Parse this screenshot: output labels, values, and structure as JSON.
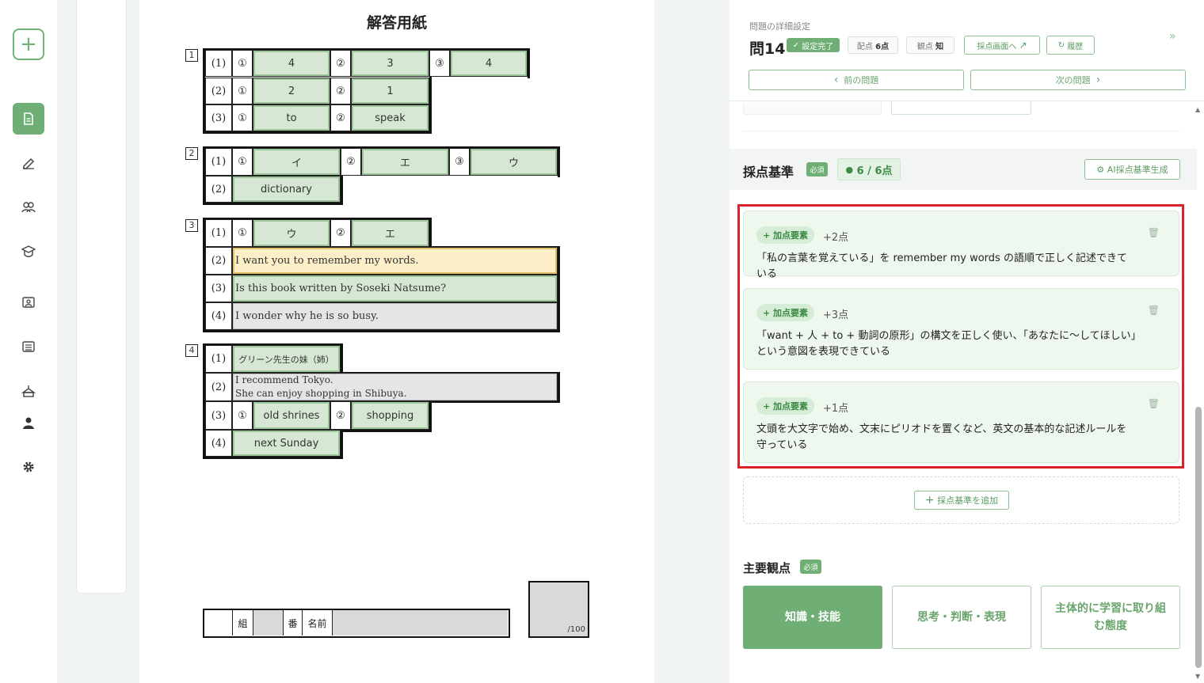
{
  "sheet": {
    "title": "解答用紙",
    "q1": {
      "num": "1",
      "rows": [
        {
          "label": "(1)",
          "m1": "①",
          "a1": "4",
          "m2": "②",
          "a2": "3",
          "m3": "③",
          "a3": "4"
        },
        {
          "label": "(2)",
          "m1": "①",
          "a1": "2",
          "m2": "②",
          "a2": "1"
        },
        {
          "label": "(3)",
          "m1": "①",
          "a1": "to",
          "m2": "②",
          "a2": "speak"
        }
      ]
    },
    "q2": {
      "num": "2",
      "rows": [
        {
          "label": "(1)",
          "m1": "①",
          "a1": "イ",
          "m2": "②",
          "a2": "エ",
          "m3": "③",
          "a3": "ウ"
        },
        {
          "label": "(2)",
          "a1": "dictionary"
        }
      ]
    },
    "q3": {
      "num": "3",
      "rows": [
        {
          "label": "(1)",
          "m1": "①",
          "a1": "ウ",
          "m2": "②",
          "a2": "エ"
        },
        {
          "label": "(2)",
          "a1": "I want you to remember my words."
        },
        {
          "label": "(3)",
          "a1": "Is this book written by Soseki Natsume?"
        },
        {
          "label": "(4)",
          "a1": "I wonder why he is so busy."
        }
      ]
    },
    "q4": {
      "num": "4",
      "rows": [
        {
          "label": "(1)",
          "a1": "グリーン先生の妹（姉）"
        },
        {
          "label": "(2)",
          "line1": "I recommend Tokyo.",
          "line2": "She can enjoy shopping in Shibuya."
        },
        {
          "label": "(3)",
          "m1": "①",
          "a1": "old shrines",
          "m2": "②",
          "a2": "shopping"
        },
        {
          "label": "(4)",
          "a1": "next Sunday"
        }
      ]
    },
    "namebar": {
      "kumi": "組",
      "ban": "番",
      "name": "名前"
    },
    "score": "/100"
  },
  "panel": {
    "heading": "問題の詳細設定",
    "question": "問14",
    "status": "設定完了",
    "points_label": "配点",
    "points_value": "6点",
    "view_label": "観点",
    "view_value": "知",
    "grading_screen": "採点画面へ",
    "history": "履歴",
    "prev": "前の問題",
    "next": "次の問題",
    "criteria_title": "採点基準",
    "required": "必須",
    "score_status": "6 / 6点",
    "ai_button": "AI採点基準生成",
    "criteria": [
      {
        "badge": "+ 加点要素",
        "points": "+2点",
        "text": "「私の言葉を覚えている」を remember my words の語順で正しく記述できている"
      },
      {
        "badge": "+ 加点要素",
        "points": "+3点",
        "text": "「want + 人 + to + 動詞の原形」の構文を正しく使い、「あなたに〜してほしい」という意図を表現できている"
      },
      {
        "badge": "+ 加点要素",
        "points": "+1点",
        "text": "文頭を大文字で始め、文末にピリオドを置くなど、英文の基本的な記述ルールを守っている"
      }
    ],
    "add_criteria": "採点基準を追加",
    "perspective_title": "主要観点",
    "perspectives": [
      "知識・技能",
      "思考・判断・表現",
      "主体的に学習に取り組む態度"
    ]
  },
  "colors": {
    "accent": "#6fae74",
    "highlight": "#d9232a"
  }
}
